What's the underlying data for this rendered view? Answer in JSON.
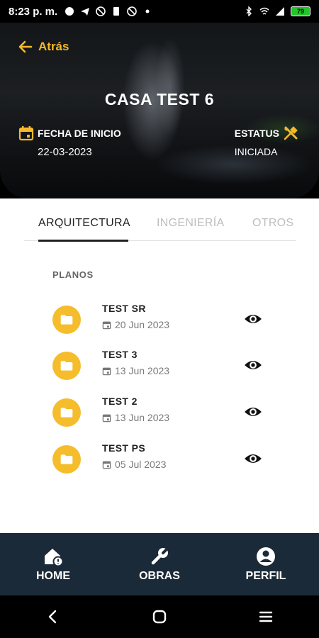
{
  "status_bar": {
    "time": "8:23 p. m.",
    "battery": "79"
  },
  "header": {
    "back_label": "Atrás",
    "title": "CASA TEST 6",
    "start_date_label": "FECHA DE INICIO",
    "start_date_value": "22-03-2023",
    "status_label": "ESTATUS",
    "status_value": "INICIADA",
    "accent_color": "#f5b92a"
  },
  "tabs": [
    {
      "label": "ARQUITECTURA",
      "active": true
    },
    {
      "label": "INGENIERÍA",
      "active": false
    },
    {
      "label": "OTROS",
      "active": false
    }
  ],
  "section": {
    "label": "PLANOS",
    "items": [
      {
        "name": "TEST SR",
        "date": "20 Jun 2023",
        "icon": "folder-icon",
        "action_icon": "eye-icon"
      },
      {
        "name": "TEST 3",
        "date": "13 Jun 2023",
        "icon": "folder-icon",
        "action_icon": "eye-icon"
      },
      {
        "name": "TEST 2",
        "date": "13 Jun 2023",
        "icon": "folder-icon",
        "action_icon": "eye-icon"
      },
      {
        "name": "TEST PS",
        "date": "05 Jul 2023",
        "icon": "folder-icon",
        "action_icon": "eye-icon"
      }
    ]
  },
  "bottom_nav": [
    {
      "label": "HOME",
      "icon": "home-icon"
    },
    {
      "label": "OBRAS",
      "icon": "wrench-icon"
    },
    {
      "label": "PERFIL",
      "icon": "account-icon"
    }
  ],
  "colors": {
    "nav_background": "#1b2a38",
    "folder": "#f5bd2b"
  }
}
